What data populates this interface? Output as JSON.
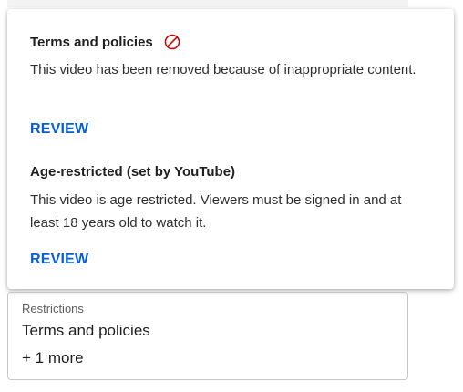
{
  "popup": {
    "sections": [
      {
        "title": "Terms and policies",
        "icon": "block-icon",
        "description": "This video has been removed because of inappropriate content.",
        "action_label": "REVIEW"
      },
      {
        "title": "Age-restricted (set by YouTube)",
        "description": "This video is age restricted. Viewers must be signed in and at least 18 years old to watch it.",
        "action_label": "REVIEW"
      }
    ]
  },
  "restrictions_field": {
    "label": "Restrictions",
    "value": "Terms and policies",
    "more": "+ 1 more"
  },
  "colors": {
    "link": "#065fd4",
    "warning": "#cc0000"
  }
}
